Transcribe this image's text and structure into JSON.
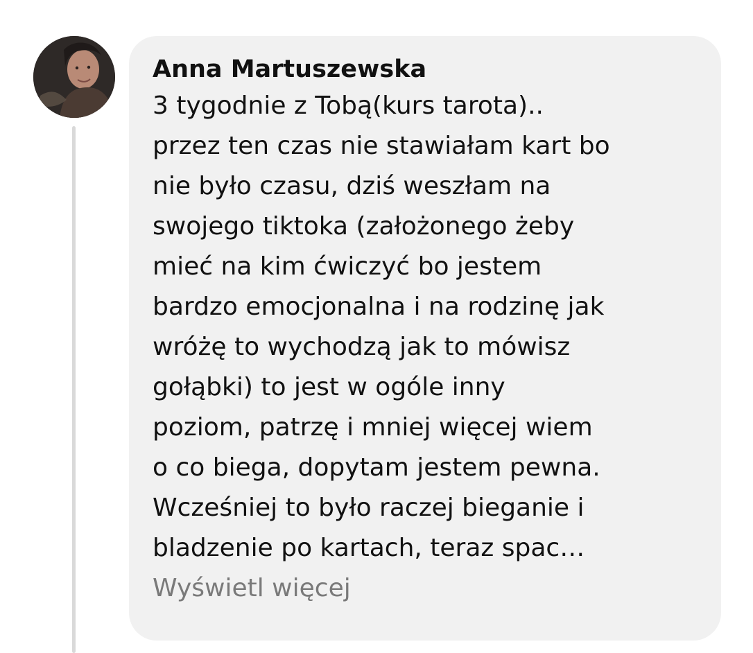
{
  "comment": {
    "author": "Anna Martuszewska",
    "lines": [
      "3 tygodnie z Tobą(kurs tarota)..",
      "przez ten czas nie stawiałam kart bo",
      "nie było czasu, dziś weszłam na",
      "swojego tiktoka (założonego żeby",
      "mieć na kim ćwiczyć bo jestem",
      "bardzo emocjonalna i na rodzinę jak",
      "wróżę to wychodzą jak to mówisz",
      "gołąbki) to jest w ogóle inny",
      "poziom, patrzę i mniej więcej wiem",
      "o co biega, dopytam jestem pewna.",
      "Wcześniej to było raczej bieganie i",
      "bladzenie po kartach, teraz spac…"
    ],
    "see_more_label": "Wyświetl więcej"
  },
  "colors": {
    "bubble_background": "#f1f1f1",
    "text": "#111111",
    "see_more": "#7a7a7a",
    "thread_line": "#d9d9d9"
  },
  "icons": {
    "avatar": "user-profile-photo"
  }
}
